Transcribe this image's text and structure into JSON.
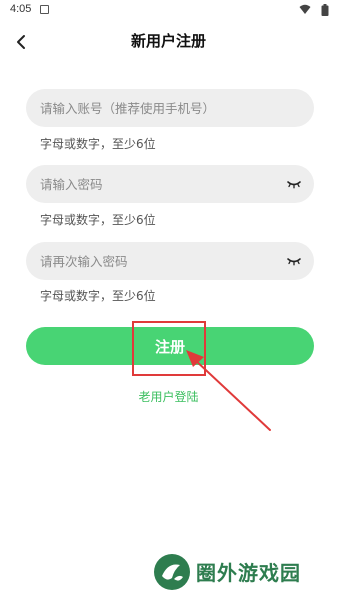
{
  "status_bar": {
    "time": "4:05",
    "notification_icon": "notification-a-icon",
    "wifi_icon": "wifi-icon",
    "battery_icon": "battery-icon"
  },
  "header": {
    "title": "新用户注册",
    "back_icon": "chevron-left-icon"
  },
  "form": {
    "account": {
      "placeholder": "请输入账号（推荐使用手机号）",
      "value": "",
      "hint": "字母或数字，至少6位"
    },
    "password": {
      "placeholder": "请输入密码",
      "value": "",
      "hint": "字母或数字，至少6位",
      "toggle_icon": "eye-closed-icon"
    },
    "confirm_password": {
      "placeholder": "请再次输入密码",
      "value": "",
      "hint": "字母或数字，至少6位",
      "toggle_icon": "eye-closed-icon"
    },
    "submit_label": "注册"
  },
  "login_link": "老用户登陆",
  "colors": {
    "primary": "#48d474",
    "link": "#3bbf5f",
    "annotation": "#e03a3a",
    "field_bg": "#eeeeee"
  },
  "watermark": {
    "text": "圈外游戏园",
    "logo_icon": "watermark-logo-icon"
  }
}
